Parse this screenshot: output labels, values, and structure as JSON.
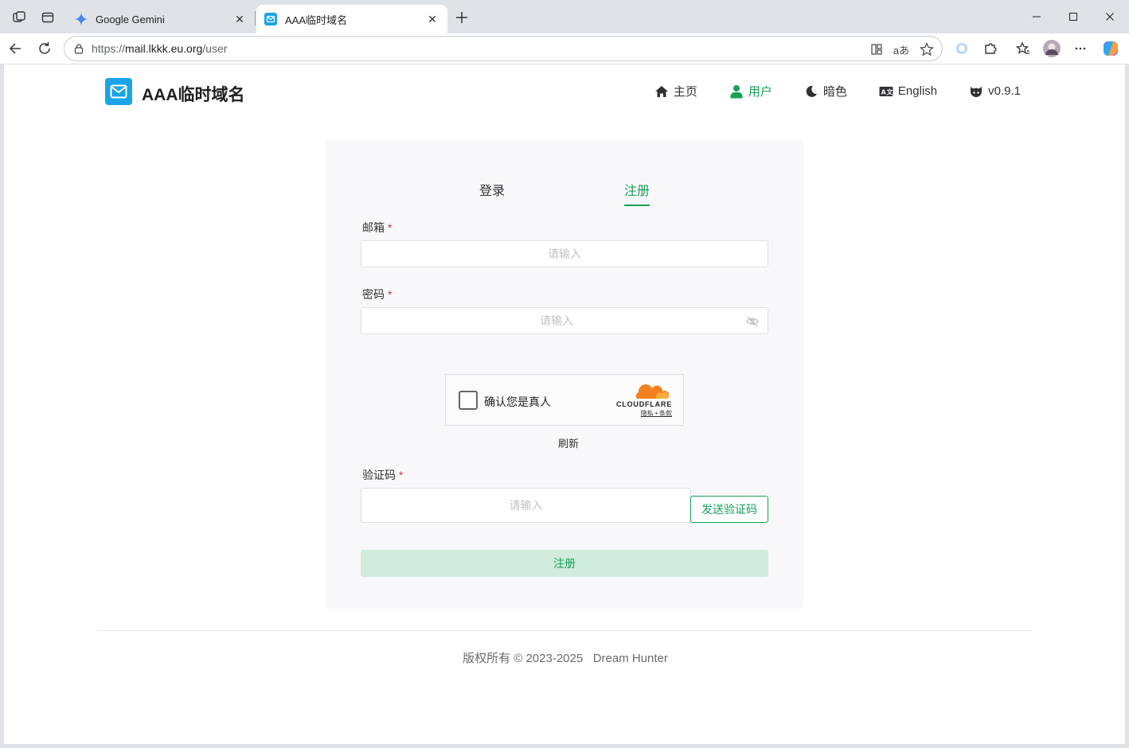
{
  "browser": {
    "tabs": [
      {
        "title": "Google Gemini",
        "active": false
      },
      {
        "title": "AAA临时域名",
        "active": true
      }
    ],
    "url": {
      "scheme": "https://",
      "host": "mail.lkkk.eu.org",
      "path": "/user"
    }
  },
  "site": {
    "title": "AAA临时域名",
    "nav": {
      "home": "主页",
      "user": "用户",
      "dark": "暗色",
      "language": "English",
      "version": "v0.9.1"
    }
  },
  "form": {
    "tabs": {
      "login": "登录",
      "register": "注册"
    },
    "email_label": "邮箱",
    "password_label": "密码",
    "code_label": "验证码",
    "required_mark": "*",
    "placeholder": "请输入",
    "captcha": {
      "label": "确认您是真人",
      "brand": "CLOUDFLARE",
      "links": "隐私 • 条款"
    },
    "refresh": "刷新",
    "send_code": "发送验证码",
    "submit": "注册"
  },
  "footer": {
    "text": "版权所有 © 2023-2025   Dream Hunter"
  },
  "colors": {
    "accent": "#18a058",
    "accent_light": "#d1ebdc",
    "required": "#d03050",
    "logo": "#1aa3e8"
  }
}
